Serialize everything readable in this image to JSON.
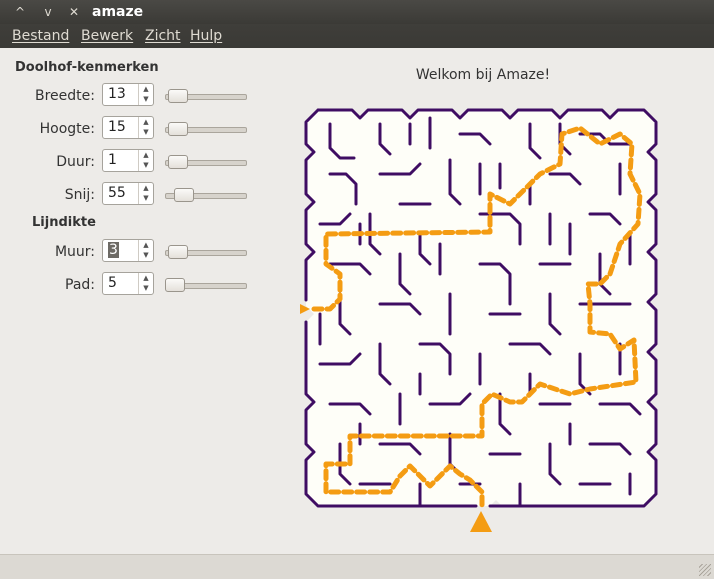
{
  "window": {
    "title": "amaze",
    "buttons": [
      "^",
      "v",
      "✕"
    ]
  },
  "menu": {
    "items": [
      "Bestand",
      "Bewerk",
      "Zicht",
      "Hulp"
    ]
  },
  "properties": {
    "heading": "Doolhof-kenmerken",
    "fields": [
      {
        "label": "Breedte:",
        "value": "13",
        "level": 0.05
      },
      {
        "label": "Hoogte:",
        "value": "15",
        "level": 0.05
      },
      {
        "label": "Duur:",
        "value": "1",
        "level": 0.05
      },
      {
        "label": "Snij:",
        "value": "55",
        "level": 0.15
      }
    ]
  },
  "linewidth": {
    "heading": "Lijndikte",
    "fields": [
      {
        "label": "Muur:",
        "value": "3",
        "level": 0.05
      },
      {
        "label": "Pad:",
        "value": "5",
        "level": 0.0
      }
    ]
  },
  "welcome": "Welkom bij Amaze!",
  "colors": {
    "wall": "#3f0d63",
    "path": "#f49c13",
    "maze_bg": "#fefef8"
  }
}
